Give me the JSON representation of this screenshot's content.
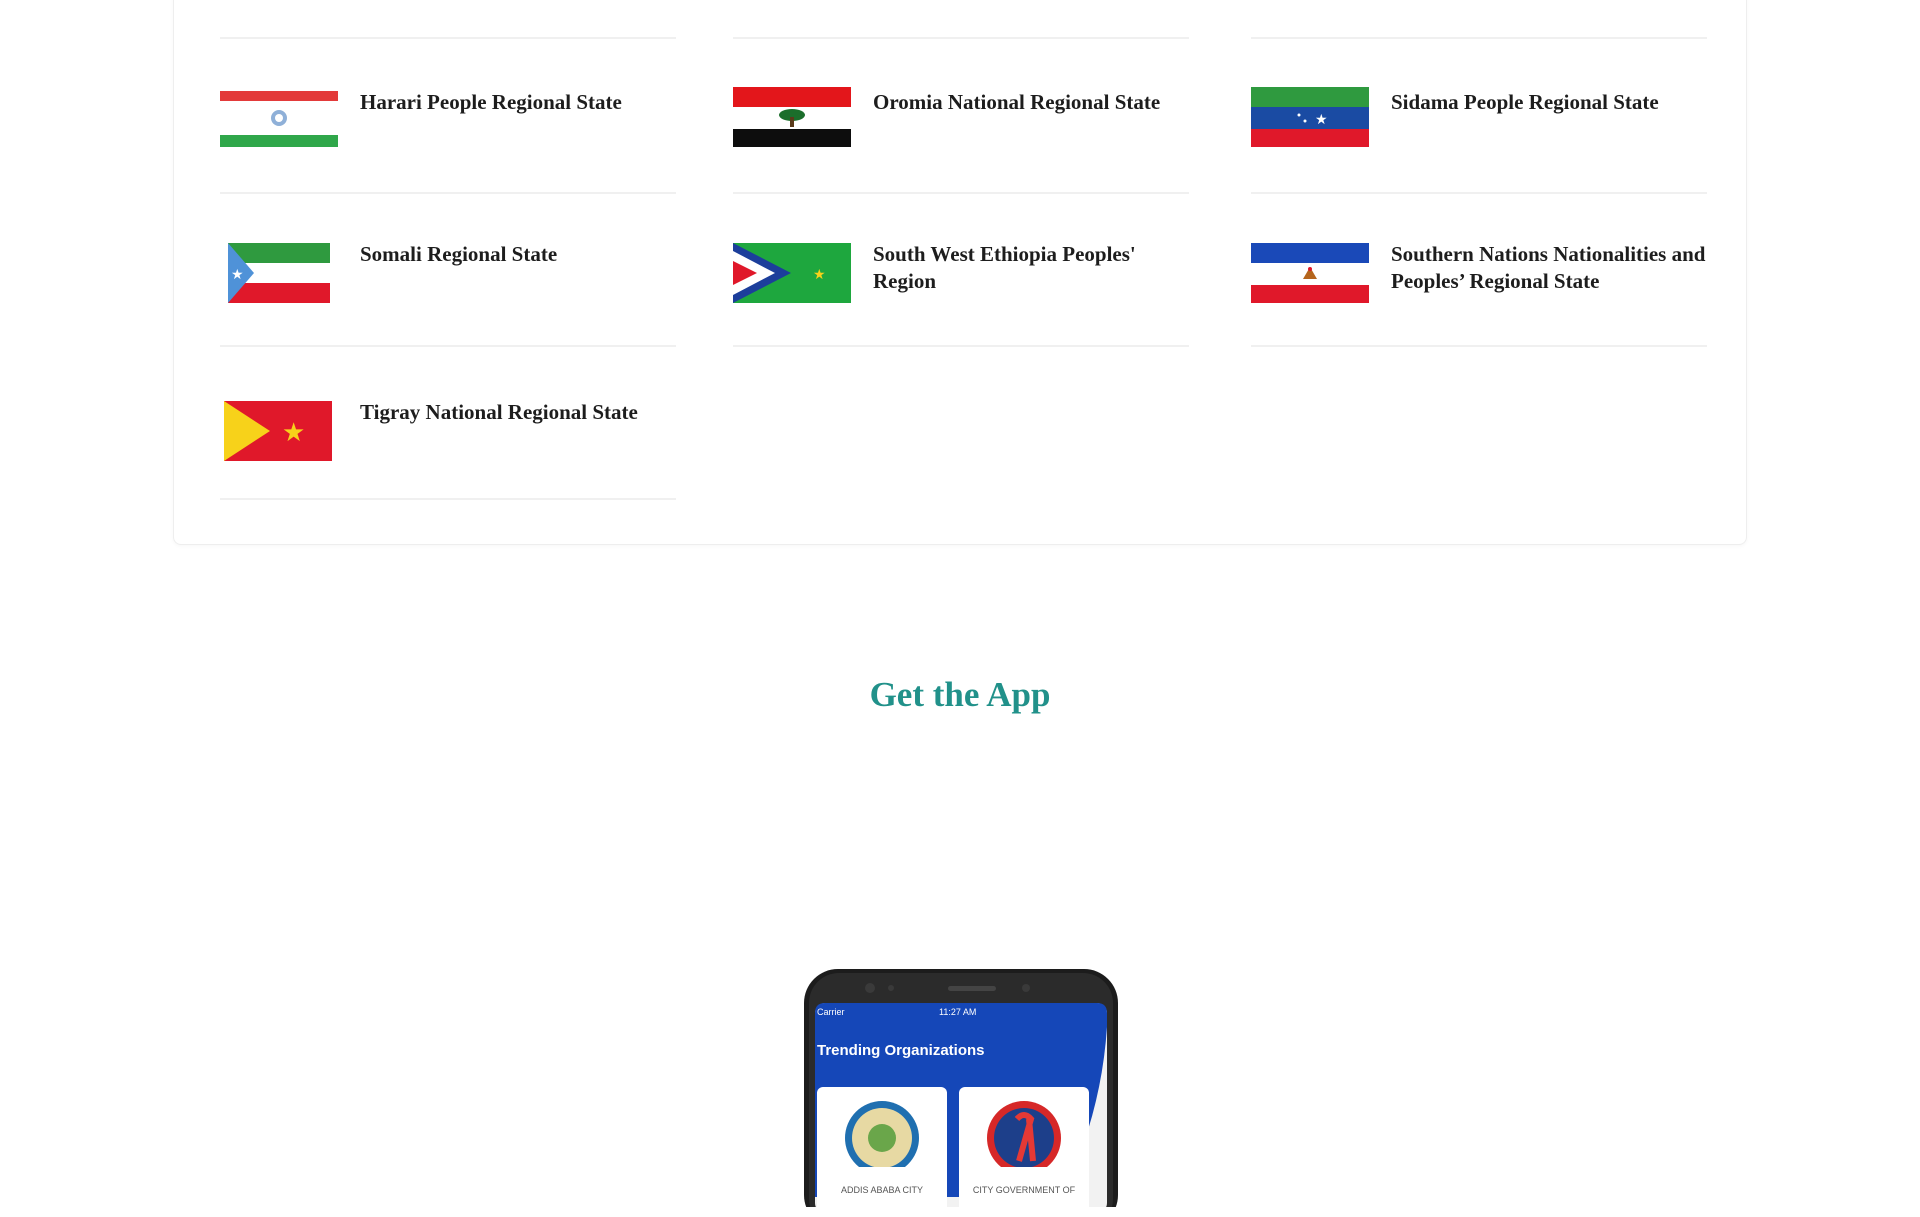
{
  "regions": [
    {
      "name": "Harari People Regional State",
      "flag": "harari-flag"
    },
    {
      "name": "Oromia National Regional State",
      "flag": "oromia-flag"
    },
    {
      "name": "Sidama People Regional State",
      "flag": "sidama-flag"
    },
    {
      "name": "Somali Regional State",
      "flag": "somali-flag"
    },
    {
      "name": "South West Ethiopia Peoples' Region",
      "flag": "south-west-ethiopia-flag"
    },
    {
      "name": "Southern Nations Nationalities and Peoples’ Regional State",
      "flag": "snnpr-flag"
    },
    {
      "name": "Tigray National Regional State",
      "flag": "tigray-flag"
    }
  ],
  "get_app": {
    "title": "Get the App"
  },
  "phone": {
    "carrier": "Carrier",
    "time": "11:27 AM",
    "screen_title": "Trending Organizations",
    "org1_label": "ADDIS ABABA CITY",
    "org2_label": "CITY GOVERNMENT OF",
    "header_color": "#1547b8"
  },
  "colors": {
    "accent": "#21918a",
    "text": "#1d1d1d"
  }
}
